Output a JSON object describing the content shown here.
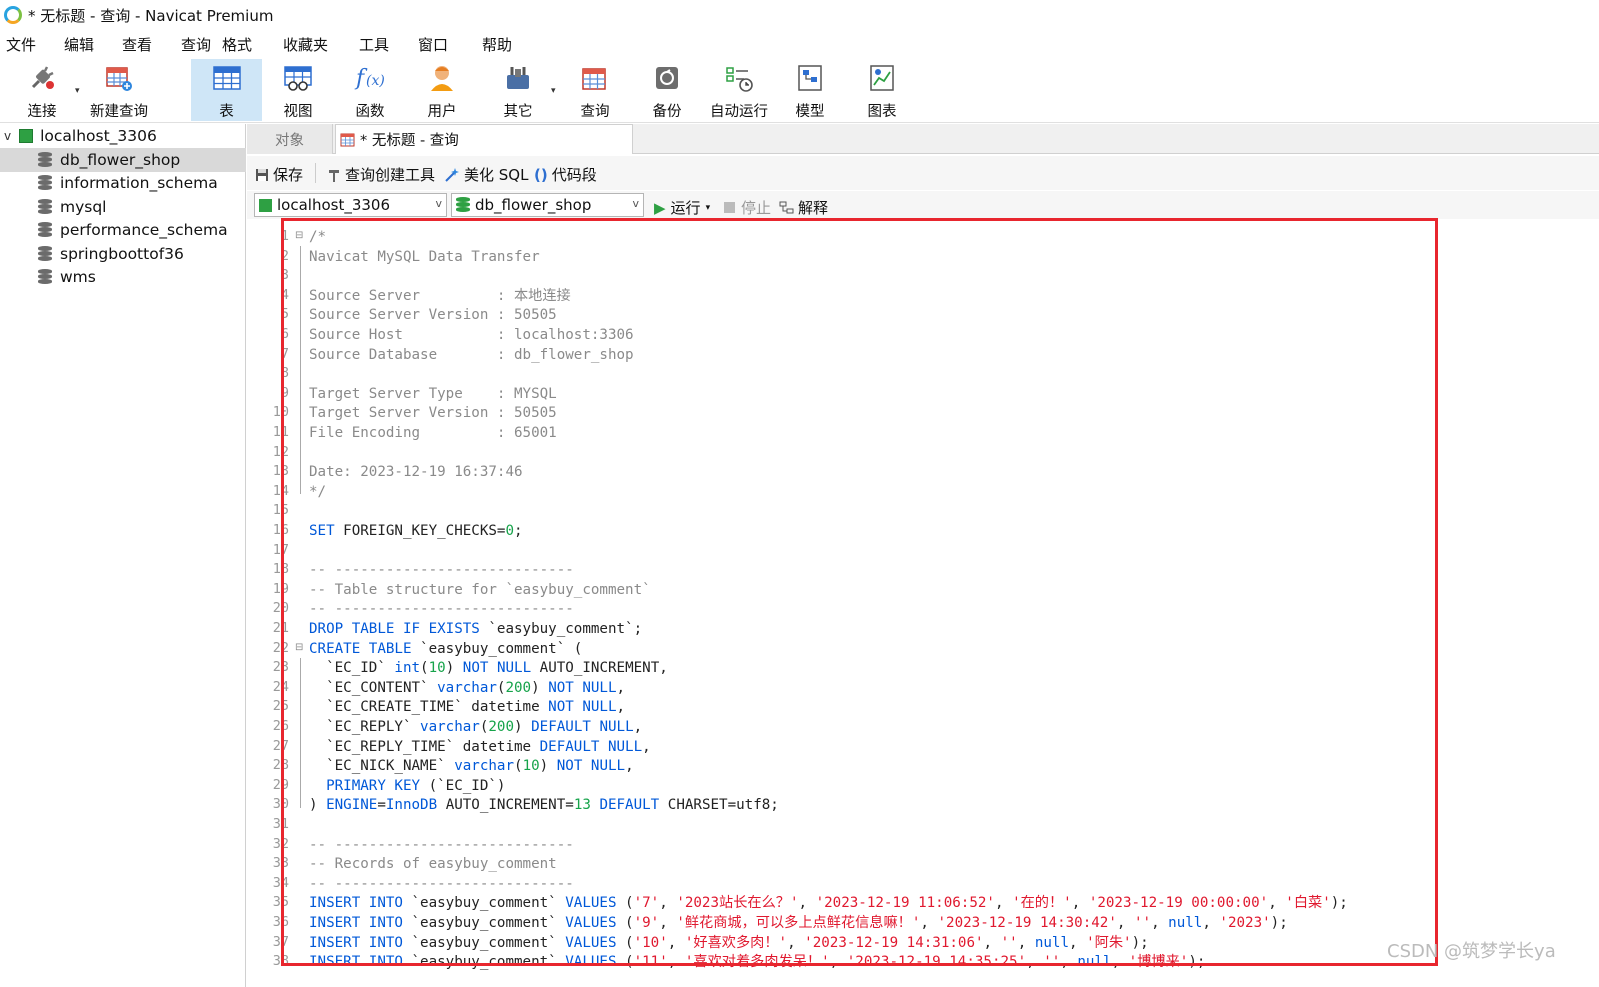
{
  "window": {
    "title": "* 无标题 - 查询 - Navicat Premium"
  },
  "menu": [
    "文件",
    "编辑",
    "查看",
    "查询",
    "格式",
    "收藏夹",
    "工具",
    "窗口",
    "帮助"
  ],
  "toolbar": {
    "connect": "连接",
    "new_query": "新建查询",
    "table": "表",
    "view": "视图",
    "function": "函数",
    "user": "用户",
    "other": "其它",
    "query": "查询",
    "backup": "备份",
    "automation": "自动运行",
    "model": "模型",
    "chart": "图表"
  },
  "tree": {
    "connection": "localhost_3306",
    "databases": [
      "db_flower_shop",
      "information_schema",
      "mysql",
      "performance_schema",
      "springboottof36",
      "wms"
    ],
    "selected_index": 0
  },
  "tabs": {
    "objects": "对象",
    "query": "* 无标题 - 查询"
  },
  "query_toolbar": {
    "save": "保存",
    "builder": "查询创建工具",
    "beautify": "美化 SQL",
    "snippet": "代码段"
  },
  "connbar": {
    "connection": "localhost_3306",
    "database": "db_flower_shop",
    "run": "运行",
    "stop": "停止",
    "explain": "解释"
  },
  "editor": {
    "line_numbers": [
      "1",
      "2",
      "3",
      "4",
      "5",
      "6",
      "7",
      "8",
      "9",
      "10",
      "11",
      "12",
      "13",
      "14",
      "15",
      "16",
      "17",
      "18",
      "19",
      "20",
      "21",
      "22",
      "23",
      "24",
      "25",
      "26",
      "27",
      "28",
      "29",
      "30",
      "31",
      "32",
      "33",
      "34",
      "35",
      "36",
      "37",
      "38"
    ],
    "lines": [
      [
        [
          "c",
          "/*"
        ]
      ],
      [
        [
          "c",
          "Navicat MySQL Data Transfer"
        ]
      ],
      [
        [
          "c",
          ""
        ]
      ],
      [
        [
          "c",
          "Source Server         : 本地连接"
        ]
      ],
      [
        [
          "c",
          "Source Server Version : 50505"
        ]
      ],
      [
        [
          "c",
          "Source Host           : localhost:3306"
        ]
      ],
      [
        [
          "c",
          "Source Database       : db_flower_shop"
        ]
      ],
      [
        [
          "c",
          ""
        ]
      ],
      [
        [
          "c",
          "Target Server Type    : MYSQL"
        ]
      ],
      [
        [
          "c",
          "Target Server Version : 50505"
        ]
      ],
      [
        [
          "c",
          "File Encoding         : 65001"
        ]
      ],
      [
        [
          "c",
          ""
        ]
      ],
      [
        [
          "c",
          "Date: 2023-12-19 16:37:46"
        ]
      ],
      [
        [
          "c",
          "*/"
        ]
      ],
      [
        [
          "p",
          ""
        ]
      ],
      [
        [
          "k",
          "SET "
        ],
        [
          "p",
          "FOREIGN_KEY_CHECKS="
        ],
        [
          "n",
          "0"
        ],
        [
          "p",
          ";"
        ]
      ],
      [
        [
          "p",
          ""
        ]
      ],
      [
        [
          "c",
          "-- ----------------------------"
        ]
      ],
      [
        [
          "c",
          "-- Table structure for `easybuy_comment`"
        ]
      ],
      [
        [
          "c",
          "-- ----------------------------"
        ]
      ],
      [
        [
          "k",
          "DROP TABLE IF EXISTS "
        ],
        [
          "p",
          "`easybuy_comment`;"
        ]
      ],
      [
        [
          "k",
          "CREATE TABLE "
        ],
        [
          "p",
          "`easybuy_comment` ("
        ]
      ],
      [
        [
          "p",
          "  `EC_ID` "
        ],
        [
          "k",
          "int"
        ],
        [
          "p",
          "("
        ],
        [
          "n",
          "10"
        ],
        [
          "p",
          ") "
        ],
        [
          "k",
          "NOT NULL "
        ],
        [
          "p",
          "AUTO_INCREMENT,"
        ]
      ],
      [
        [
          "p",
          "  `EC_CONTENT` "
        ],
        [
          "k",
          "varchar"
        ],
        [
          "p",
          "("
        ],
        [
          "n",
          "200"
        ],
        [
          "p",
          ") "
        ],
        [
          "k",
          "NOT NULL"
        ],
        [
          "p",
          ","
        ]
      ],
      [
        [
          "p",
          "  `EC_CREATE_TIME` datetime "
        ],
        [
          "k",
          "NOT NULL"
        ],
        [
          "p",
          ","
        ]
      ],
      [
        [
          "p",
          "  `EC_REPLY` "
        ],
        [
          "k",
          "varchar"
        ],
        [
          "p",
          "("
        ],
        [
          "n",
          "200"
        ],
        [
          "p",
          ") "
        ],
        [
          "k",
          "DEFAULT NULL"
        ],
        [
          "p",
          ","
        ]
      ],
      [
        [
          "p",
          "  `EC_REPLY_TIME` datetime "
        ],
        [
          "k",
          "DEFAULT NULL"
        ],
        [
          "p",
          ","
        ]
      ],
      [
        [
          "p",
          "  `EC_NICK_NAME` "
        ],
        [
          "k",
          "varchar"
        ],
        [
          "p",
          "("
        ],
        [
          "n",
          "10"
        ],
        [
          "p",
          ") "
        ],
        [
          "k",
          "NOT NULL"
        ],
        [
          "p",
          ","
        ]
      ],
      [
        [
          "k",
          "  PRIMARY KEY "
        ],
        [
          "p",
          "(`EC_ID`)"
        ]
      ],
      [
        [
          "p",
          ") "
        ],
        [
          "k",
          "ENGINE"
        ],
        [
          "p",
          "="
        ],
        [
          "k",
          "InnoDB "
        ],
        [
          "p",
          "AUTO_INCREMENT="
        ],
        [
          "n",
          "13 "
        ],
        [
          "k",
          "DEFAULT "
        ],
        [
          "p",
          "CHARSET=utf8;"
        ]
      ],
      [
        [
          "p",
          ""
        ]
      ],
      [
        [
          "c",
          "-- ----------------------------"
        ]
      ],
      [
        [
          "c",
          "-- Records of easybuy_comment"
        ]
      ],
      [
        [
          "c",
          "-- ----------------------------"
        ]
      ],
      [
        [
          "k",
          "INSERT INTO "
        ],
        [
          "p",
          "`easybuy_comment` "
        ],
        [
          "k",
          "VALUES "
        ],
        [
          "p",
          "("
        ],
        [
          "s",
          "'7'"
        ],
        [
          "p",
          ", "
        ],
        [
          "s",
          "'2023站长在么？'"
        ],
        [
          "p",
          ", "
        ],
        [
          "s",
          "'2023-12-19 11:06:52'"
        ],
        [
          "p",
          ", "
        ],
        [
          "s",
          "'在的！'"
        ],
        [
          "p",
          ", "
        ],
        [
          "s",
          "'2023-12-19 00:00:00'"
        ],
        [
          "p",
          ", "
        ],
        [
          "s",
          "'白菜'"
        ],
        [
          "p",
          ");"
        ]
      ],
      [
        [
          "k",
          "INSERT INTO "
        ],
        [
          "p",
          "`easybuy_comment` "
        ],
        [
          "k",
          "VALUES "
        ],
        [
          "p",
          "("
        ],
        [
          "s",
          "'9'"
        ],
        [
          "p",
          ", "
        ],
        [
          "s",
          "'鲜花商城，可以多上点鲜花信息嘛！'"
        ],
        [
          "p",
          ", "
        ],
        [
          "s",
          "'2023-12-19 14:30:42'"
        ],
        [
          "p",
          ", "
        ],
        [
          "s",
          "''"
        ],
        [
          "p",
          ", "
        ],
        [
          "k",
          "null"
        ],
        [
          "p",
          ", "
        ],
        [
          "s",
          "'2023'"
        ],
        [
          "p",
          ");"
        ]
      ],
      [
        [
          "k",
          "INSERT INTO "
        ],
        [
          "p",
          "`easybuy_comment` "
        ],
        [
          "k",
          "VALUES "
        ],
        [
          "p",
          "("
        ],
        [
          "s",
          "'10'"
        ],
        [
          "p",
          ", "
        ],
        [
          "s",
          "'好喜欢多肉！'"
        ],
        [
          "p",
          ", "
        ],
        [
          "s",
          "'2023-12-19 14:31:06'"
        ],
        [
          "p",
          ", "
        ],
        [
          "s",
          "''"
        ],
        [
          "p",
          ", "
        ],
        [
          "k",
          "null"
        ],
        [
          "p",
          ", "
        ],
        [
          "s",
          "'阿朱'"
        ],
        [
          "p",
          ");"
        ]
      ],
      [
        [
          "k",
          "INSERT INTO "
        ],
        [
          "p",
          "`easybuy_comment` "
        ],
        [
          "k",
          "VALUES "
        ],
        [
          "p",
          "("
        ],
        [
          "s",
          "'11'"
        ],
        [
          "p",
          ", "
        ],
        [
          "s",
          "'喜欢对着多肉发呆！'"
        ],
        [
          "p",
          ", "
        ],
        [
          "s",
          "'2023-12-19 14:35:25'"
        ],
        [
          "p",
          ", "
        ],
        [
          "s",
          "''"
        ],
        [
          "p",
          ", "
        ],
        [
          "k",
          "null"
        ],
        [
          "p",
          ", "
        ],
        [
          "s",
          "'博博来'"
        ],
        [
          "p",
          ");"
        ]
      ]
    ]
  },
  "watermark": "CSDN @筑梦学长ya"
}
